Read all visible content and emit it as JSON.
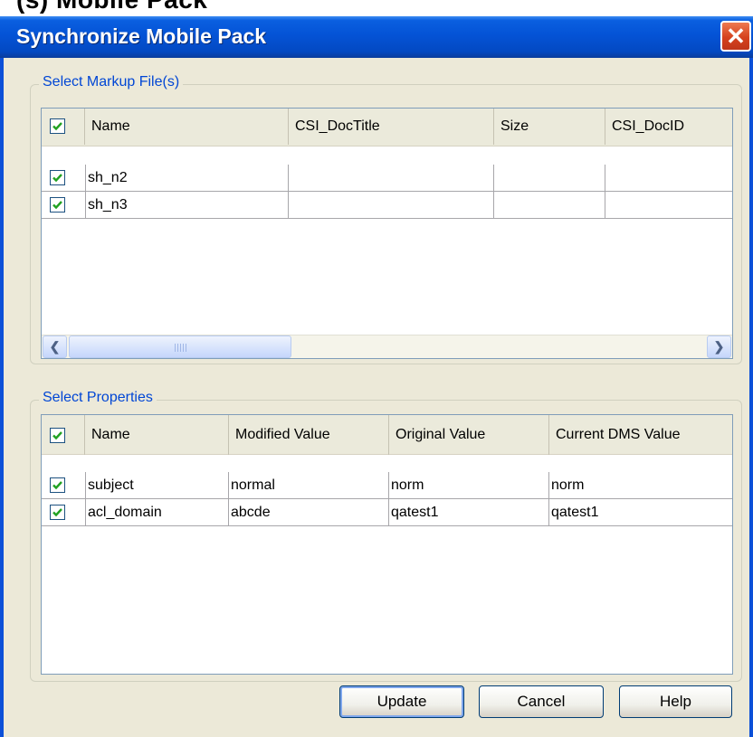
{
  "background_text": "(s)   Mobile   Pack",
  "dialog": {
    "title": "Synchronize Mobile Pack",
    "close_glyph": "✕"
  },
  "markup_group": {
    "label": "Select Markup File(s)",
    "columns": [
      "Name",
      "CSI_DocTitle",
      "Size",
      "CSI_DocID"
    ],
    "rows": [
      {
        "checked": true,
        "cells": [
          "sh_n2",
          "",
          "",
          ""
        ]
      },
      {
        "checked": true,
        "cells": [
          "sh_n3",
          "",
          "",
          ""
        ]
      }
    ],
    "scrollbar": {
      "left_arrow": "❮",
      "right_arrow": "❯"
    }
  },
  "properties_group": {
    "label": "Select Properties",
    "columns": [
      "Name",
      "Modified Value",
      "Original Value",
      "Current DMS Value"
    ],
    "rows": [
      {
        "checked": true,
        "cells": [
          "subject",
          "normal",
          "norm",
          "norm"
        ]
      },
      {
        "checked": true,
        "cells": [
          "acl_domain",
          "abcde",
          "qatest1",
          "qatest1"
        ]
      }
    ]
  },
  "buttons": {
    "update": "Update",
    "cancel": "Cancel",
    "help": "Help"
  },
  "colors": {
    "titlebar": "#0453d6",
    "group_label": "#0046d5",
    "checkmark": "#21a121",
    "dialog_bg": "#ece9d8"
  }
}
